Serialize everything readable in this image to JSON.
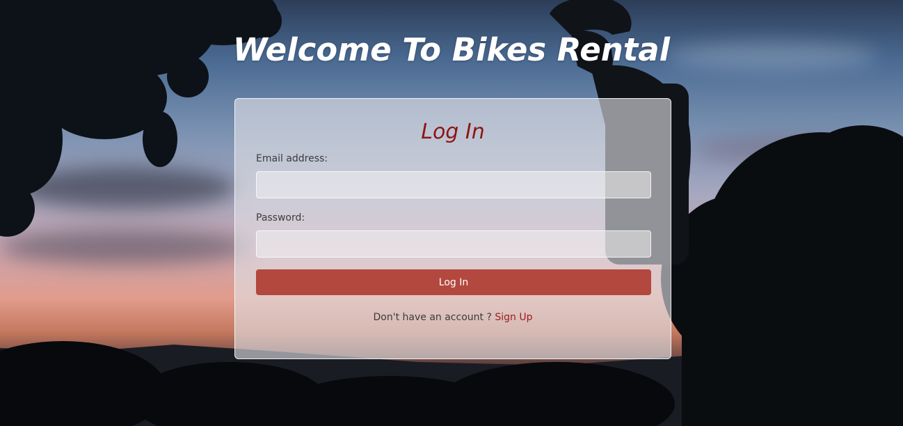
{
  "page": {
    "title": "Welcome To Bikes Rental"
  },
  "login": {
    "heading": "Log In",
    "email_label": "Email address:",
    "email_value": "",
    "password_label": "Password:",
    "password_value": "",
    "submit_label": "Log In",
    "no_account_text": "Don't have an account ?",
    "signup_link_label": "Sign Up"
  },
  "colors": {
    "accent_button": "#b3483f",
    "heading_text": "#8f1414",
    "link_text": "#9a1c1c"
  }
}
